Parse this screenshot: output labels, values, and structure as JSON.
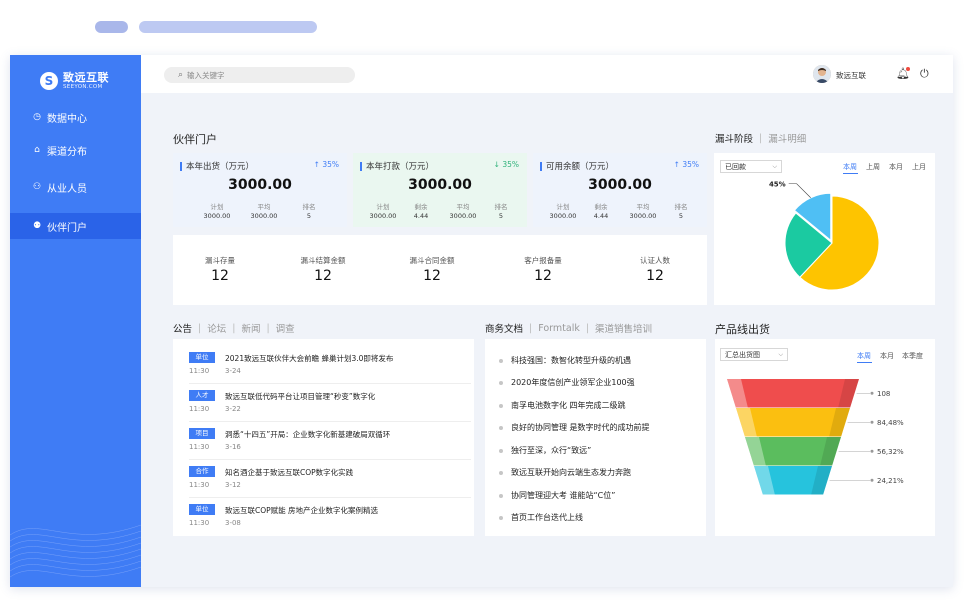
{
  "brand": {
    "name_cn": "致远互联",
    "name_en": "SEEYON.COM"
  },
  "sidebar": {
    "items": [
      {
        "label": "数据中心",
        "icon": "clock-icon",
        "active": false
      },
      {
        "label": "渠道分布",
        "icon": "home-icon",
        "active": false
      },
      {
        "label": "从业人员",
        "icon": "user-icon",
        "active": false
      },
      {
        "label": "伙伴门户",
        "icon": "group-icon",
        "active": true
      }
    ]
  },
  "topbar": {
    "search_placeholder": "输入关键字",
    "user_name": "致远互联"
  },
  "partner_portal": {
    "title": "伙伴门户",
    "kpis": [
      {
        "title": "本年出货（万元）",
        "trend": "up",
        "trend_label": "35%",
        "value": "3000.00",
        "color": "#eef3fc",
        "subs": [
          {
            "label": "计划",
            "value": "3000.00"
          },
          {
            "label": "平均",
            "value": "3000.00"
          },
          {
            "label": "排名",
            "value": "5"
          }
        ]
      },
      {
        "title": "本年打款（万元）",
        "trend": "down",
        "trend_label": "35%",
        "value": "3000.00",
        "color": "#eaf7f0",
        "subs": [
          {
            "label": "计划",
            "value": "3000.00"
          },
          {
            "label": "剩余",
            "value": "4.44"
          },
          {
            "label": "平均",
            "value": "3000.00"
          },
          {
            "label": "排名",
            "value": "5"
          }
        ]
      },
      {
        "title": "可用余额（万元）",
        "trend": "up",
        "trend_label": "35%",
        "value": "3000.00",
        "color": "#eef3fc",
        "subs": [
          {
            "label": "计划",
            "value": "3000.00"
          },
          {
            "label": "剩余",
            "value": "4.44"
          },
          {
            "label": "平均",
            "value": "3000.00"
          },
          {
            "label": "排名",
            "value": "5"
          }
        ]
      }
    ],
    "stats": [
      {
        "label": "漏斗存量",
        "value": "12"
      },
      {
        "label": "漏斗结算金额",
        "value": "12"
      },
      {
        "label": "漏斗合同金额",
        "value": "12"
      },
      {
        "label": "客户报备量",
        "value": "12"
      },
      {
        "label": "认证人数",
        "value": "12"
      }
    ]
  },
  "funnel_stage": {
    "tabs": [
      "漏斗阶段",
      "漏斗明细"
    ],
    "dropdown": "已回款",
    "periods": [
      "本周",
      "上周",
      "本月",
      "上月"
    ],
    "active_period": "本周"
  },
  "announcements": {
    "tabs": [
      "公告",
      "论坛",
      "新闻",
      "调查"
    ],
    "items": [
      {
        "tag": "单位",
        "title": "2021致远互联伙伴大会前瞻 蜂巢计划3.0即将发布",
        "time": "11:30",
        "date": "3-24"
      },
      {
        "tag": "人才",
        "title": "致远互联低代码平台让项目管理“秒变”数字化",
        "time": "11:30",
        "date": "3-22"
      },
      {
        "tag": "项目",
        "title": "洞悉“十四五”开局：企业数字化新基建破局双循环",
        "time": "11:30",
        "date": "3-16"
      },
      {
        "tag": "合作",
        "title": "知名酒企基于致远互联COP数字化实践",
        "time": "11:30",
        "date": "3-12"
      },
      {
        "tag": "单位",
        "title": "致远互联COP赋能 房地产企业数字化案例精选",
        "time": "11:30",
        "date": "3-08"
      }
    ]
  },
  "business_docs": {
    "tabs": [
      "商务文档",
      "Formtalk",
      "渠道销售培训"
    ],
    "items": [
      "科技强国：数智化转型升级的机遇",
      "2020年度信创产业领军企业100强",
      "南孚电池数字化 四年完成二级跳",
      "良好的协同管理 是数字时代的成功前提",
      "独行至深，众行“致远”",
      "致远互联开始向云端生态发力奔跑",
      "协同管理迎大考 谁能站“C位”",
      "首页工作台迭代上线"
    ]
  },
  "product_shipment": {
    "title": "产品线出货",
    "dropdown": "汇总出货图",
    "periods": [
      "本周",
      "本月",
      "本季度"
    ],
    "active_period": "本周"
  },
  "chart_data": [
    {
      "type": "pie",
      "labels": [
        "",
        "",
        ""
      ],
      "values": [
        62,
        24,
        14
      ],
      "colors": [
        "#fec400",
        "#1bcaa1",
        "#4fbff4"
      ],
      "data_labels": [
        "",
        "",
        "45%"
      ]
    },
    {
      "type": "funnel",
      "values_labels": [
        "108",
        "84,48%",
        "56,32%",
        "24,21%"
      ],
      "colors": [
        "#ef4d4d",
        "#fbbf10",
        "#5bbd5e",
        "#26c3dd"
      ]
    }
  ]
}
